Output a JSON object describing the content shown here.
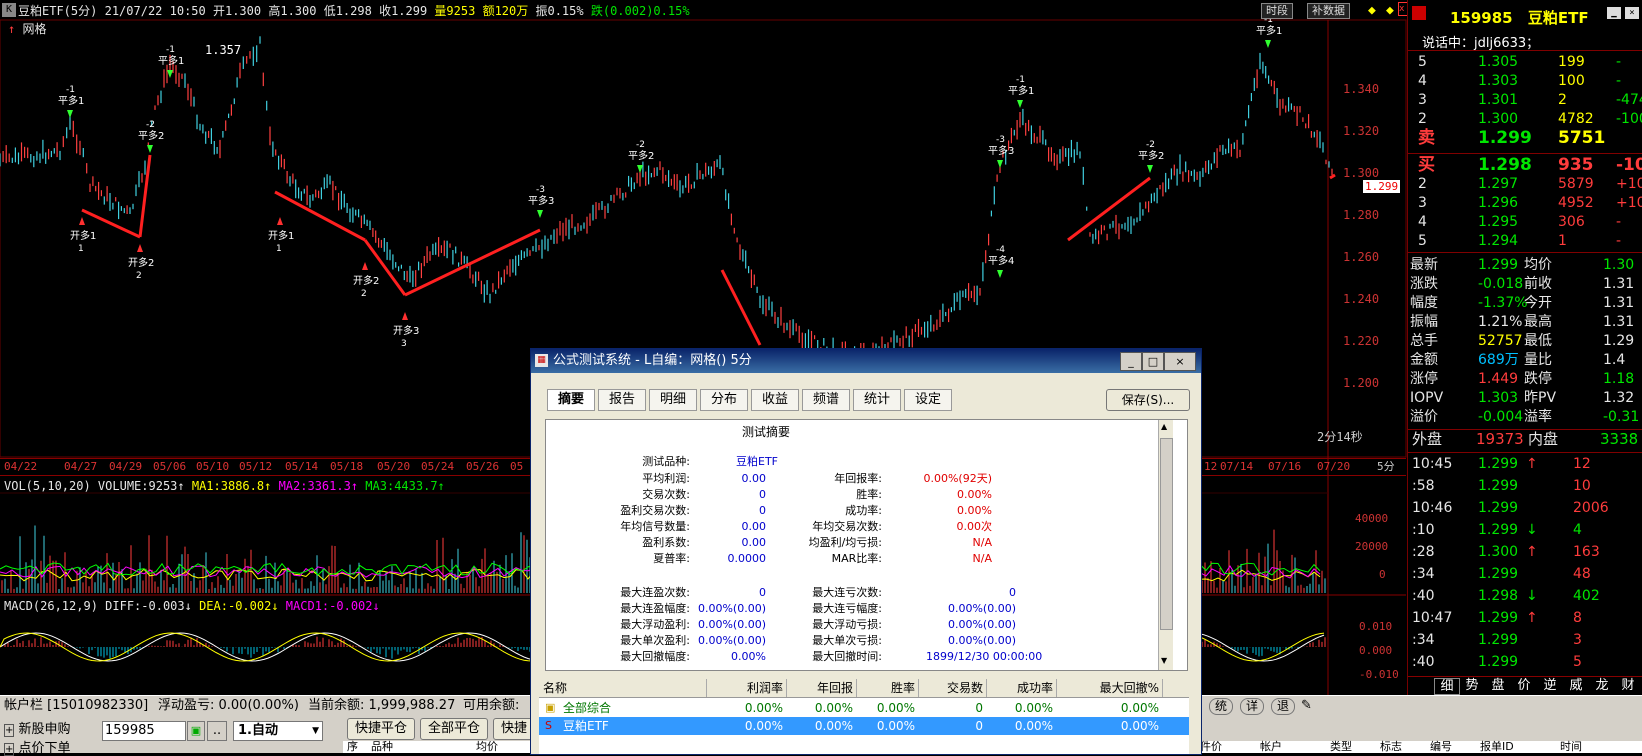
{
  "header": {
    "logo": "K",
    "symbol_period": "豆粕ETF(5分)",
    "date_time": "21/07/22 10:50",
    "open": "开1.300",
    "high": "高1.300",
    "low": "低1.298",
    "close": "收1.299",
    "volume": "量9253",
    "amount": "额120万",
    "amplitude": "振0.15%",
    "change": "跌(0.002)0.15%",
    "btn_time": "时段",
    "btn_fill": "补数据",
    "indicator_name": "网格"
  },
  "chart": {
    "price_labels": [
      "1.340",
      "1.320",
      "1.300",
      "1.280",
      "1.260",
      "1.240",
      "1.220",
      "1.200"
    ],
    "current_price": "1.299",
    "max_label": "1.357",
    "countdown": "2分14秒",
    "dates": [
      "04/22",
      "04/27",
      "04/29",
      "05/06",
      "05/10",
      "05/12",
      "05/14",
      "05/18",
      "05/20",
      "05/24",
      "05/26",
      "05",
      "12",
      "07/14",
      "07/16",
      "07/20"
    ],
    "period_label": "5分",
    "signals": [
      {
        "text": "开多1",
        "sub": "1"
      },
      {
        "text": "开多2",
        "sub": "2"
      },
      {
        "text": "平多1",
        "sub": "-1"
      },
      {
        "text": "平多2",
        "sub": "-2"
      },
      {
        "text": "开多3",
        "sub": "3"
      },
      {
        "text": "平多3",
        "sub": "-3"
      },
      {
        "text": "平多4",
        "sub": "-4"
      }
    ]
  },
  "vol": {
    "label": "VOL(5,10,20) VOLUME:9253↑",
    "ma1": "MA1:3886.8↑",
    "ma2": "MA2:3361.3↑",
    "ma3": "MA3:4433.7↑",
    "axis": [
      "40000",
      "20000",
      "0"
    ]
  },
  "macd": {
    "label": "MACD(26,12,9) DIFF:-0.003↓",
    "dea": "DEA:-0.002↓",
    "macd": "MACD1:-0.002↓",
    "axis": [
      "0.010",
      "0.000",
      "-0.010"
    ]
  },
  "quote": {
    "code": "159985",
    "name": "豆粕ETF",
    "talk": "说话中：jdlj6633；",
    "ask": [
      {
        "lvl": "5",
        "price": "1.305",
        "vol": "199",
        "chg": "-"
      },
      {
        "lvl": "4",
        "price": "1.303",
        "vol": "100",
        "chg": "-"
      },
      {
        "lvl": "3",
        "price": "1.301",
        "vol": "2",
        "chg": "-474"
      },
      {
        "lvl": "2",
        "price": "1.300",
        "vol": "4782",
        "chg": "-100"
      },
      {
        "lvl": "卖",
        "price": "1.299",
        "vol": "5751",
        "chg": ""
      }
    ],
    "bid": [
      {
        "lvl": "买",
        "price": "1.298",
        "vol": "935",
        "chg": "-100"
      },
      {
        "lvl": "2",
        "price": "1.297",
        "vol": "5879",
        "chg": "+100"
      },
      {
        "lvl": "3",
        "price": "1.296",
        "vol": "4952",
        "chg": "+10"
      },
      {
        "lvl": "4",
        "price": "1.295",
        "vol": "306",
        "chg": "-"
      },
      {
        "lvl": "5",
        "price": "1.294",
        "vol": "1",
        "chg": "-"
      }
    ],
    "stats": [
      {
        "k1": "最新",
        "v1": "1.299",
        "k2": "均价",
        "v2": "1.30"
      },
      {
        "k1": "涨跌",
        "v1": "-0.018",
        "k2": "前收",
        "v2": "1.31"
      },
      {
        "k1": "幅度",
        "v1": "-1.37%",
        "k2": "今开",
        "v2": "1.31"
      },
      {
        "k1": "振幅",
        "v1": "1.21%",
        "k2": "最高",
        "v2": "1.31"
      },
      {
        "k1": "总手",
        "v1": "52757",
        "k2": "最低",
        "v2": "1.29"
      },
      {
        "k1": "金额",
        "v1": "689万",
        "k2": "量比",
        "v2": "1.4"
      },
      {
        "k1": "涨停",
        "v1": "1.449",
        "k2": "跌停",
        "v2": "1.18"
      },
      {
        "k1": "IOPV",
        "v1": "1.303",
        "k2": "昨PV",
        "v2": "1.32"
      },
      {
        "k1": "溢价",
        "v1": "-0.004",
        "k2": "溢率",
        "v2": "-0.31"
      }
    ],
    "outer": {
      "k1": "外盘",
      "v1": "19373",
      "k2": "内盘",
      "v2": "3338"
    },
    "ticks": [
      {
        "t": "10:45",
        "p": "1.299",
        "a": "↑",
        "v": "12"
      },
      {
        "t": ":58",
        "p": "1.299",
        "a": "",
        "v": "10"
      },
      {
        "t": "10:46",
        "p": "1.299",
        "a": "",
        "v": "2006"
      },
      {
        "t": ":10",
        "p": "1.299",
        "a": "↓",
        "v": "4"
      },
      {
        "t": ":28",
        "p": "1.300",
        "a": "↑",
        "v": "163"
      },
      {
        "t": ":34",
        "p": "1.299",
        "a": "",
        "v": "48"
      },
      {
        "t": ":40",
        "p": "1.298",
        "a": "↓",
        "v": "402"
      },
      {
        "t": "10:47",
        "p": "1.299",
        "a": "↑",
        "v": "8"
      },
      {
        "t": ":34",
        "p": "1.299",
        "a": "",
        "v": "3"
      },
      {
        "t": ":40",
        "p": "1.299",
        "a": "",
        "v": "5"
      }
    ],
    "tabs": [
      "细",
      "势",
      "盘",
      "价",
      "逆",
      "威",
      "龙",
      "财"
    ]
  },
  "bottom": {
    "account": "帐户栏 [15010982330]",
    "float_pl": "浮动盈亏: 0.00(0.00%)",
    "balance": "当前余额: 1,999,988.27",
    "available": "可用余额:",
    "new_ipo": "新股申购",
    "order": "点价下单",
    "code_input": "159985",
    "mode": "1.自动",
    "quick_close": "快捷平仓",
    "close_all": "全部平仓",
    "quick_more": "快捷",
    "col_seq": "序",
    "col_name": "品种",
    "col_avg": "均价",
    "right_btns": [
      "统",
      "详",
      "退"
    ],
    "right_cols": [
      "件价",
      "帐户",
      "类型",
      "标志",
      "编号",
      "报单ID",
      "时间"
    ]
  },
  "dialog": {
    "title": "公式测试系统 - L自编：网格() 5分",
    "tabs": [
      "摘要",
      "报告",
      "明细",
      "分布",
      "收益",
      "频谱",
      "统计",
      "设定"
    ],
    "save": "保存(S)...",
    "summary_title": "测试摘要",
    "instrument_label": "测试品种:",
    "instrument": "豆粕ETF",
    "left_rows": [
      {
        "k": "平均利润:",
        "v": "0.00"
      },
      {
        "k": "交易次数:",
        "v": "0"
      },
      {
        "k": "盈利交易次数:",
        "v": "0"
      },
      {
        "k": "年均信号数量:",
        "v": "0.00"
      },
      {
        "k": "盈利系数:",
        "v": "0.00"
      },
      {
        "k": "夏普率:",
        "v": "0.0000"
      }
    ],
    "right_rows": [
      {
        "k": "年回报率:",
        "v": "0.00%(92天)"
      },
      {
        "k": "胜率:",
        "v": "0.00%"
      },
      {
        "k": "成功率:",
        "v": "0.00%"
      },
      {
        "k": "年均交易次数:",
        "v": "0.00次"
      },
      {
        "k": "均盈利/均亏损:",
        "v": "N/A"
      },
      {
        "k": "MAR比率:",
        "v": "N/A"
      }
    ],
    "left_rows2": [
      {
        "k": "最大连盈次数:",
        "v": "0"
      },
      {
        "k": "最大连盈幅度:",
        "v": "0.00%(0.00)"
      },
      {
        "k": "最大浮动盈利:",
        "v": "0.00%(0.00)"
      },
      {
        "k": "最大单次盈利:",
        "v": "0.00%(0.00)"
      },
      {
        "k": "最大回撤幅度:",
        "v": "0.00%"
      }
    ],
    "right_rows2": [
      {
        "k": "最大连亏次数:",
        "v": "0"
      },
      {
        "k": "最大连亏幅度:",
        "v": "0.00%(0.00)"
      },
      {
        "k": "最大浮动亏损:",
        "v": "0.00%(0.00)"
      },
      {
        "k": "最大单次亏损:",
        "v": "0.00%(0.00)"
      },
      {
        "k": "最大回撤时间:",
        "v": "1899/12/30 00:00:00"
      }
    ],
    "table_headers": [
      "名称",
      "利润率",
      "年回报",
      "胜率",
      "交易数",
      "成功率",
      "最大回撤%"
    ],
    "table_rows": [
      [
        "全部综合",
        "0.00%",
        "0.00%",
        "0.00%",
        "0",
        "0.00%",
        "0.00%"
      ],
      [
        "豆粕ETF",
        "0.00%",
        "0.00%",
        "0.00%",
        "0",
        "0.00%",
        "0.00%"
      ]
    ]
  }
}
